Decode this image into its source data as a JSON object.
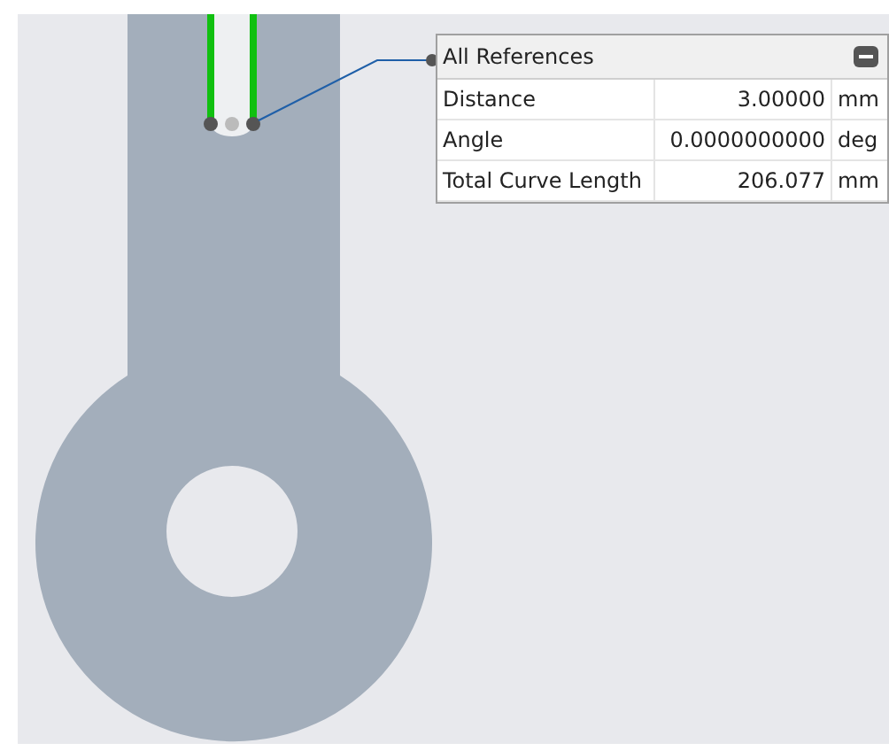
{
  "panel": {
    "title": "All References",
    "rows": [
      {
        "label": "Distance",
        "value": "3.00000",
        "unit": "mm"
      },
      {
        "label": "Angle",
        "value": "0.0000000000",
        "unit": "deg"
      },
      {
        "label": "Total Curve Length",
        "value": "206.077",
        "unit": "mm"
      }
    ]
  }
}
